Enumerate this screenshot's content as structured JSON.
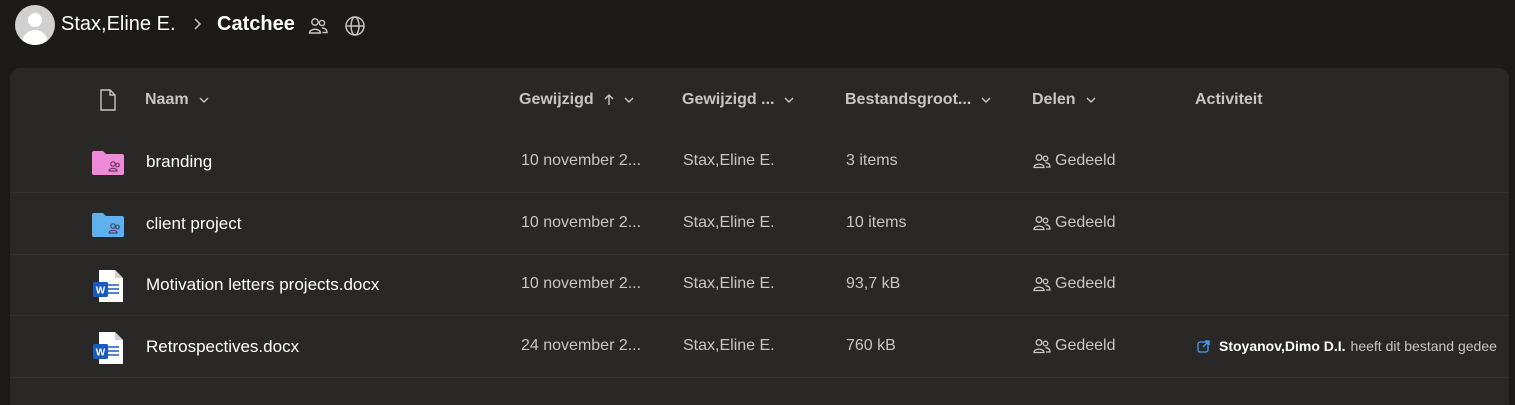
{
  "breadcrumb": {
    "user": "Stax,Eline E.",
    "site": "Catchee",
    "site_icons": [
      "people-icon",
      "globe-icon"
    ]
  },
  "columns": {
    "name": "Naam",
    "modified": "Gewijzigd",
    "modified_by": "Gewijzigd ...",
    "size": "Bestandsgroot...",
    "sharing": "Delen",
    "activity": "Activiteit"
  },
  "sort": {
    "column": "modified",
    "direction": "ascending"
  },
  "files": [
    {
      "name": "branding",
      "type": "folder",
      "icon": "shared-folder-icon",
      "color": "#f08ad8",
      "modified": "10 november 2...",
      "modified_by": "Stax,Eline E.",
      "size": "3 items",
      "sharing": "Gedeeld",
      "activity_user": "",
      "activity_text": ""
    },
    {
      "name": "client project",
      "type": "folder",
      "icon": "shared-folder-icon",
      "color": "#5fb0ec",
      "modified": "10 november 2...",
      "modified_by": "Stax,Eline E.",
      "size": "10 items",
      "sharing": "Gedeeld",
      "activity_user": "",
      "activity_text": ""
    },
    {
      "name": "Motivation letters projects.docx",
      "type": "docx",
      "icon": "word-document-icon",
      "color": "#185abd",
      "modified": "10 november 2...",
      "modified_by": "Stax,Eline E.",
      "size": "93,7 kB",
      "sharing": "Gedeeld",
      "activity_user": "",
      "activity_text": ""
    },
    {
      "name": "Retrospectives.docx",
      "type": "docx",
      "icon": "word-document-icon",
      "color": "#185abd",
      "modified": "24 november 2...",
      "modified_by": "Stax,Eline E.",
      "size": "760 kB",
      "sharing": "Gedeeld",
      "activity_user": "Stoyanov,Dimo D.I.",
      "activity_text": "heeft dit bestand gedee"
    }
  ],
  "colors": {
    "background": "#1b1a19",
    "panel": "#292827",
    "muted_text": "#c8c6c4",
    "accent": "#479ef5"
  }
}
